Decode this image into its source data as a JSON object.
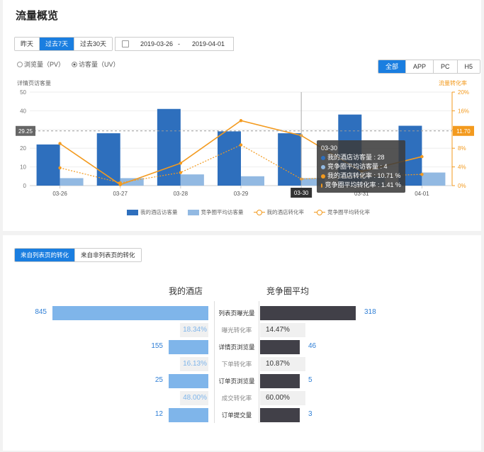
{
  "header": {
    "title": "流量概览"
  },
  "range_tabs": [
    "昨天",
    "过去7天",
    "过去30天"
  ],
  "range_active": 1,
  "date_range": {
    "start": "2019-03-26",
    "sep": "-",
    "end": "2019-04-01"
  },
  "metric_radios": [
    {
      "label": "浏览量（PV）",
      "selected": false
    },
    {
      "label": "访客量（UV）",
      "selected": true
    }
  ],
  "platform_tabs": [
    "全部",
    "APP",
    "PC",
    "H5"
  ],
  "platform_active": 0,
  "chart_data": {
    "type": "bar",
    "ylabel": "详情页访客量",
    "y2label": "流量转化率",
    "ylim": [
      0,
      50
    ],
    "y2lim": [
      0,
      20
    ],
    "yticks": [
      "0",
      "10",
      "20",
      "30",
      "40",
      "50"
    ],
    "y2ticks": [
      "0%",
      "4%",
      "8%",
      "12%",
      "16%",
      "20%"
    ],
    "categories": [
      "03-26",
      "03-27",
      "03-28",
      "03-29",
      "03-30",
      "03-31",
      "04-01"
    ],
    "series": [
      {
        "name": "我的酒店访客量",
        "kind": "bar",
        "color": "#2e6fbd",
        "values": [
          22,
          28,
          41,
          29,
          28,
          38,
          32
        ]
      },
      {
        "name": "竞争圈平均访客量",
        "kind": "bar",
        "color": "#92b9e2",
        "values": [
          4,
          4,
          6,
          5,
          4,
          5,
          7
        ]
      },
      {
        "name": "我的酒店转化率",
        "kind": "line",
        "color": "#f39a1e",
        "dashed": false,
        "values": [
          9.0,
          0.2,
          4.8,
          13.9,
          10.71,
          3.0,
          6.2
        ]
      },
      {
        "name": "竞争圈平均转化率",
        "kind": "line",
        "color": "#f39a1e",
        "dashed": true,
        "values": [
          3.8,
          0.6,
          2.8,
          8.7,
          1.41,
          2.0,
          2.4
        ]
      }
    ],
    "crosshair_y_label": "29.25",
    "crosshair_y2_label": "11.70",
    "hover_category": "03-30",
    "tooltip": {
      "title": "03-30",
      "rows": [
        {
          "text": "我的酒店访客量 : 28",
          "color": "#2e6fbd"
        },
        {
          "text": "竞争圈平均访客量 : 4",
          "color": "#92b9e2"
        },
        {
          "text": "我的酒店转化率 : 10.71 %",
          "color": "#f39a1e"
        },
        {
          "text": "竞争圈平均转化率 : 1.41 %",
          "color": "#f39a1e"
        }
      ]
    }
  },
  "funnel_tabs": [
    "来自列表页的转化",
    "来自非列表页的转化"
  ],
  "funnel_active": 0,
  "funnel": {
    "left_title": "我的酒店",
    "right_title": "竞争圈平均",
    "rows": [
      {
        "type": "stage",
        "label": "列表页曝光量",
        "left": "845",
        "right": "318",
        "left_v": 845,
        "right_v": 318
      },
      {
        "type": "rate",
        "label": "曝光转化率",
        "left": "18.34%",
        "right": "14.47%"
      },
      {
        "type": "stage",
        "label": "详情页浏览量",
        "left": "155",
        "right": "46",
        "left_v": 155,
        "right_v": 46
      },
      {
        "type": "rate",
        "label": "下单转化率",
        "left": "16.13%",
        "right": "10.87%"
      },
      {
        "type": "stage",
        "label": "订单页浏览量",
        "left": "25",
        "right": "5",
        "left_v": 25,
        "right_v": 5
      },
      {
        "type": "rate",
        "label": "成交转化率",
        "left": "48.00%",
        "right": "60.00%"
      },
      {
        "type": "stage",
        "label": "订单提交量",
        "left": "12",
        "right": "3",
        "left_v": 12,
        "right_v": 3
      }
    ]
  }
}
